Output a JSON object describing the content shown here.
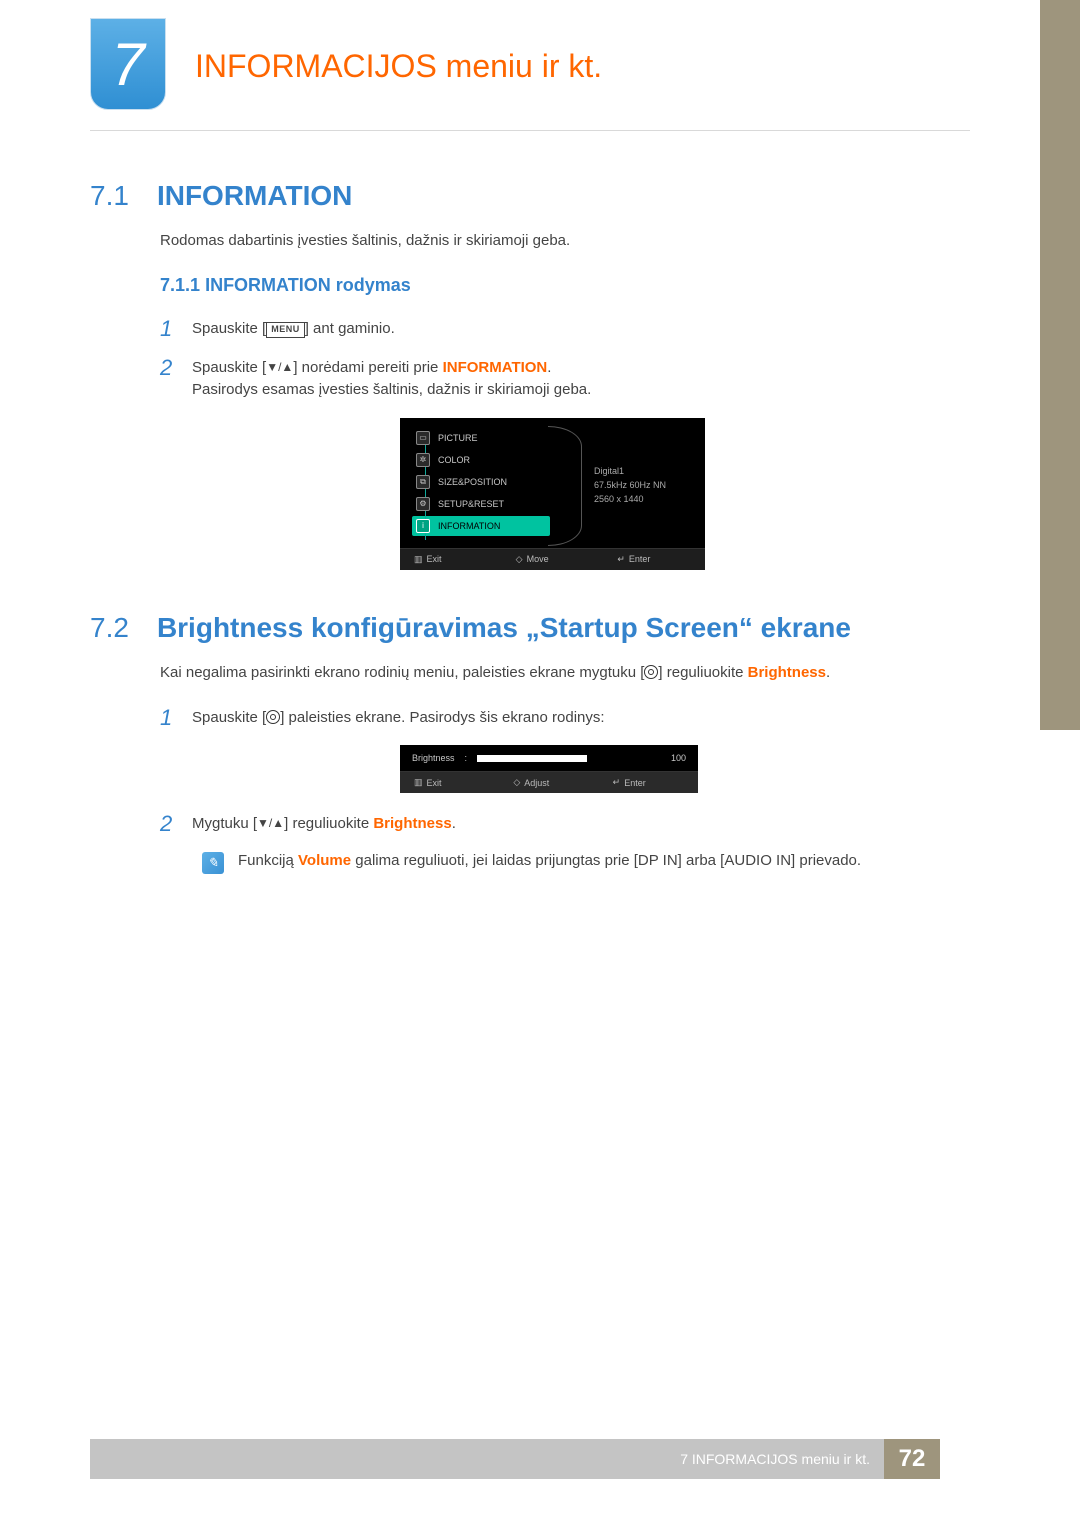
{
  "chapter": {
    "number": "7",
    "title": "INFORMACIJOS meniu ir kt."
  },
  "section71": {
    "idx": "7.1",
    "title": "INFORMATION",
    "intro": "Rodomas dabartinis įvesties šaltinis, dažnis ir skiriamoji geba.",
    "sub_idx": "7.1.1",
    "sub_title": "INFORMATION rodymas",
    "step1_a": "Spauskite [",
    "step1_menu": "MENU",
    "step1_b": "] ant gaminio.",
    "step2_a": "Spauskite [",
    "step2_b": "] norėdami pereiti prie ",
    "step2_c": "INFORMATION",
    "step2_d": ".",
    "step2_e": "Pasirodys esamas įvesties šaltinis, dažnis ir skiriamoji geba."
  },
  "osd_menu": {
    "items": [
      "PICTURE",
      "COLOR",
      "SIZE&POSITION",
      "SETUP&RESET",
      "INFORMATION"
    ],
    "info_lines": [
      "Digital1",
      "67.5kHz 60Hz NN",
      "2560 x 1440"
    ],
    "footer": {
      "exit": "Exit",
      "move": "Move",
      "enter": "Enter"
    }
  },
  "section72": {
    "idx": "7.2",
    "title": "Brightness konfigūravimas „Startup Screen“ ekrane",
    "intro_a": "Kai negalima pasirinkti ekrano rodinių meniu, paleisties ekrane mygtuku [",
    "intro_b": "] reguliuokite ",
    "intro_c": "Brightness",
    "intro_d": ".",
    "step1_a": "Spauskite [",
    "step1_b": "] paleisties ekrane. Pasirodys šis ekrano rodinys:",
    "step2_a": "Mygtuku [",
    "step2_b": "] reguliuokite ",
    "step2_c": "Brightness",
    "step2_d": ".",
    "note_a": "Funkciją ",
    "note_b": "Volume",
    "note_c": "  galima reguliuoti, jei laidas prijungtas prie [DP IN] arba [AUDIO IN] prievado."
  },
  "osd_bright": {
    "label": "Brightness",
    "sep": ":",
    "value": "100",
    "footer": {
      "exit": "Exit",
      "adjust": "Adjust",
      "enter": "Enter"
    }
  },
  "footer": {
    "label": "7 INFORMACIJOS meniu ir kt.",
    "page": "72"
  }
}
